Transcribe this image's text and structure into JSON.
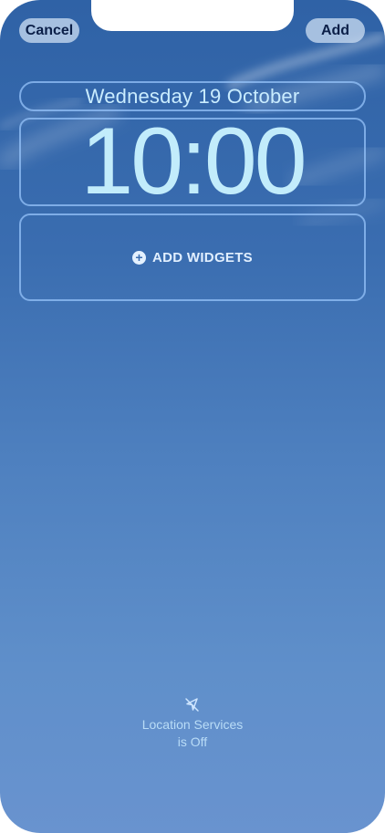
{
  "toolbar": {
    "cancel_label": "Cancel",
    "add_label": "Add"
  },
  "lock_screen": {
    "date": "Wednesday 19 October",
    "time": "10:00",
    "widgets_label": "ADD WIDGETS",
    "widgets_icon": "plus-circle-icon"
  },
  "location_status": {
    "icon": "location-off-icon",
    "line1": "Location Services",
    "line2": "is Off"
  },
  "colors": {
    "sky_top": "#2f62a6",
    "sky_bottom": "#6993cf",
    "accent_text": "#c2ecfb"
  }
}
